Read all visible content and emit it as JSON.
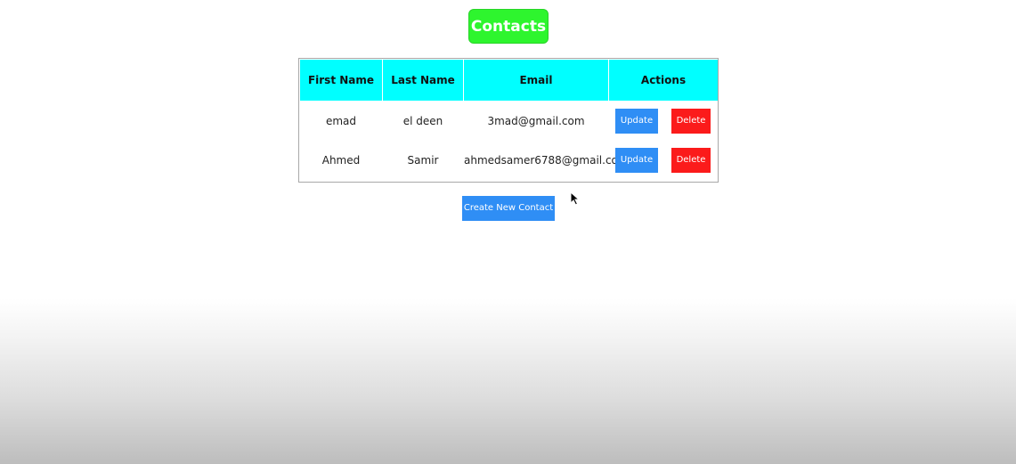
{
  "page": {
    "title": "Contacts"
  },
  "table": {
    "headers": [
      "First Name",
      "Last Name",
      "Email",
      "Actions"
    ],
    "rows": [
      {
        "first_name": "emad",
        "last_name": "el deen",
        "email": "3mad@gmail.com",
        "update_label": "Update",
        "delete_label": "Delete"
      },
      {
        "first_name": "Ahmed",
        "last_name": "Samir",
        "email": "ahmedsamer6788@gmail.com",
        "update_label": "Update",
        "delete_label": "Delete"
      }
    ]
  },
  "actions": {
    "create_label": "Create New Contact"
  },
  "colors": {
    "title_bg": "#2ef52e",
    "header_bg": "#00ffff",
    "update_bg": "#2f8ef5",
    "delete_bg": "#fb1b1b",
    "create_bg": "#2f8ef5"
  },
  "icons": {
    "cursor": "mouse-pointer-icon"
  }
}
